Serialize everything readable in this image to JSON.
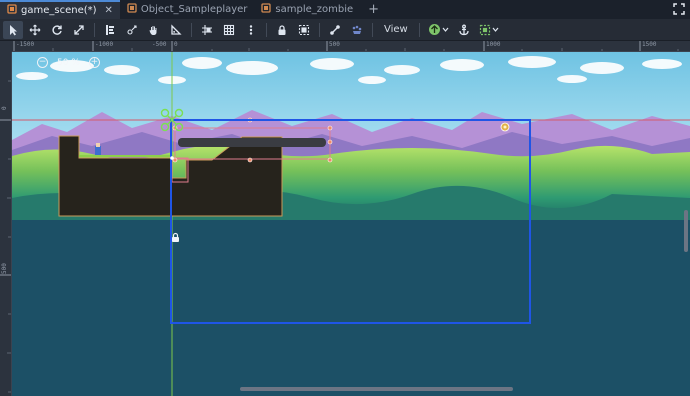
{
  "tabs": [
    {
      "label": "game_scene(*)",
      "icon": "scene-icon",
      "active": true
    },
    {
      "label": "Object_Sampleplayer",
      "icon": "scene-icon",
      "active": false
    },
    {
      "label": "sample_zombie",
      "icon": "scene-icon",
      "active": false
    }
  ],
  "toolbar": {
    "view_label": "View",
    "tools": [
      "select-tool-icon",
      "move-tool-icon",
      "rotate-tool-icon",
      "scale-tool-icon",
      "selectable-list-icon",
      "pivot-tool-icon",
      "pan-tool-icon",
      "ruler-tool-icon",
      "smart-snap-icon",
      "grid-snap-icon",
      "more-options-icon",
      "lock-icon",
      "group-icon",
      "skeleton-icon",
      "particles-icon"
    ]
  },
  "ruler": {
    "top_labels": [
      "-1500",
      "-1000",
      "-500",
      "0",
      "500",
      "1000",
      "1500"
    ],
    "left_labels": [
      "0",
      "500"
    ]
  },
  "viewport": {
    "zoom": "50 %",
    "colors": {
      "background": "#1c5066",
      "camera_frame": "#1f55e6",
      "terrain": "#26231c",
      "sky": "#7ecbe6"
    }
  }
}
